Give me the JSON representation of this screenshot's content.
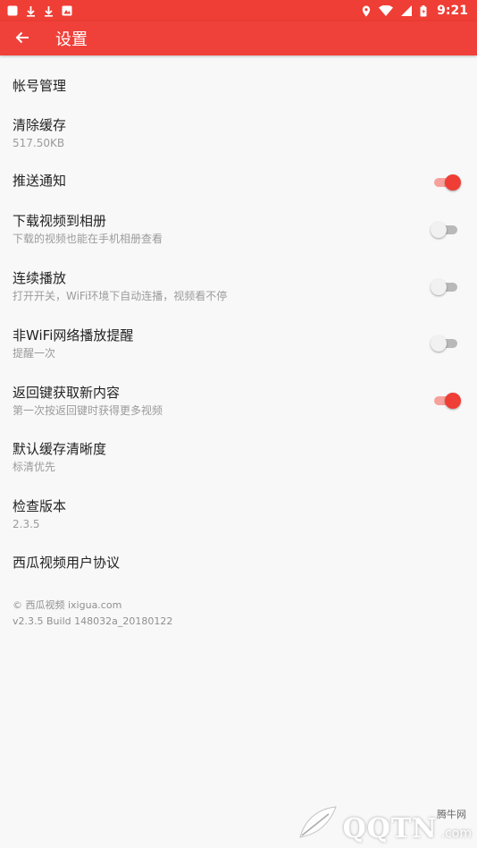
{
  "status_bar": {
    "time": "9:21",
    "left_icons": [
      "notification-square-icon",
      "download-icon",
      "download-icon",
      "image-icon"
    ],
    "right_icons": [
      "location-icon",
      "wifi-icon",
      "signal-icon",
      "battery-icon"
    ]
  },
  "app_bar": {
    "title": "设置",
    "back_icon": "arrow-left-icon",
    "color": "#f0403a"
  },
  "settings": [
    {
      "title": "帐号管理"
    },
    {
      "title": "清除缓存",
      "subtitle": "517.50KB"
    },
    {
      "title": "推送通知",
      "toggle": true
    },
    {
      "title": "下载视频到相册",
      "subtitle": "下载的视频也能在手机相册查看",
      "toggle": false
    },
    {
      "title": "连续播放",
      "subtitle": "打开开关，WiFi环境下自动连播，视频看不停",
      "toggle": false
    },
    {
      "title": "非WiFi网络播放提醒",
      "subtitle": "提醒一次",
      "toggle": false
    },
    {
      "title": "返回键获取新内容",
      "subtitle": "第一次按返回键时获得更多视频",
      "toggle": true
    },
    {
      "title": "默认缓存清晰度",
      "subtitle": "标清优先"
    },
    {
      "title": "检查版本",
      "subtitle": "2.3.5"
    },
    {
      "title": "西瓜视频用户协议"
    }
  ],
  "footer": {
    "copyright": "© 西瓜视频 ixigua.com",
    "build": "v2.3.5 Build 148032a_20180122"
  },
  "watermark": {
    "logo_text": "QQTN",
    "suffix": ".com",
    "site_name": "腾牛网"
  },
  "colors": {
    "accent": "#ee3e35",
    "toggle_on_track": "#f7a19c",
    "toggle_off_track": "#b9b9b9"
  }
}
